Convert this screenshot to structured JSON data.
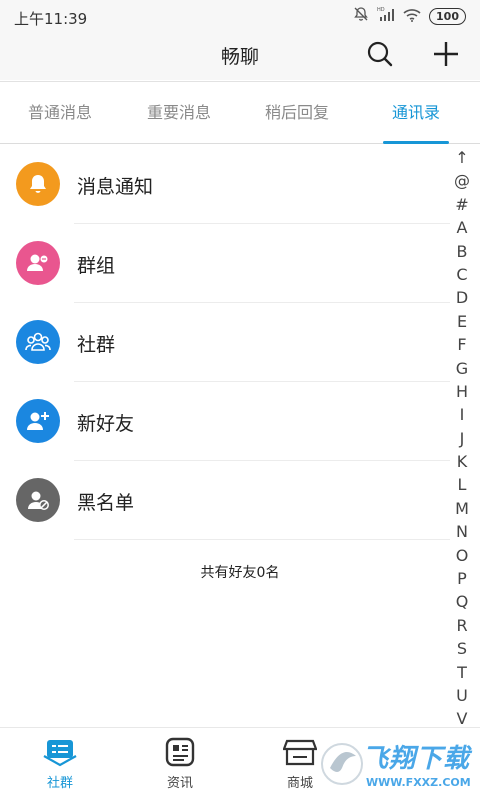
{
  "status_bar": {
    "time": "上午11:39",
    "battery": "100"
  },
  "header": {
    "title": "畅聊",
    "search_icon": "search-icon",
    "add_icon": "plus-icon"
  },
  "tabs": [
    {
      "label": "普通消息",
      "active": false
    },
    {
      "label": "重要消息",
      "active": false
    },
    {
      "label": "稍后回复",
      "active": false
    },
    {
      "label": "通讯录",
      "active": true
    }
  ],
  "contacts_menu": [
    {
      "label": "消息通知",
      "icon": "bell-icon",
      "color": "#f39a1e"
    },
    {
      "label": "群组",
      "icon": "group-icon",
      "color": "#e9568f"
    },
    {
      "label": "社群",
      "icon": "community-icon",
      "color": "#1b87e0"
    },
    {
      "label": "新好友",
      "icon": "add-friend-icon",
      "color": "#1b87e0"
    },
    {
      "label": "黑名单",
      "icon": "blacklist-icon",
      "color": "#666666"
    }
  ],
  "friend_count": "共有好友0名",
  "index_letters": [
    "↑",
    "@",
    "#",
    "A",
    "B",
    "C",
    "D",
    "E",
    "F",
    "G",
    "H",
    "I",
    "J",
    "K",
    "L",
    "M",
    "N",
    "O",
    "P",
    "Q",
    "R",
    "S",
    "T",
    "U",
    "V"
  ],
  "bottom_nav": [
    {
      "label": "社群",
      "icon": "community-list-icon",
      "active": true
    },
    {
      "label": "资讯",
      "icon": "news-icon",
      "active": false
    },
    {
      "label": "商城",
      "icon": "store-icon",
      "active": false
    }
  ],
  "watermark": {
    "text": "飞翔下载",
    "url": "WWW.FXXZ.COM"
  },
  "colors": {
    "accent": "#1796d6",
    "orange": "#f39a1e",
    "pink": "#e9568f",
    "blue": "#1b87e0",
    "gray": "#666666"
  }
}
